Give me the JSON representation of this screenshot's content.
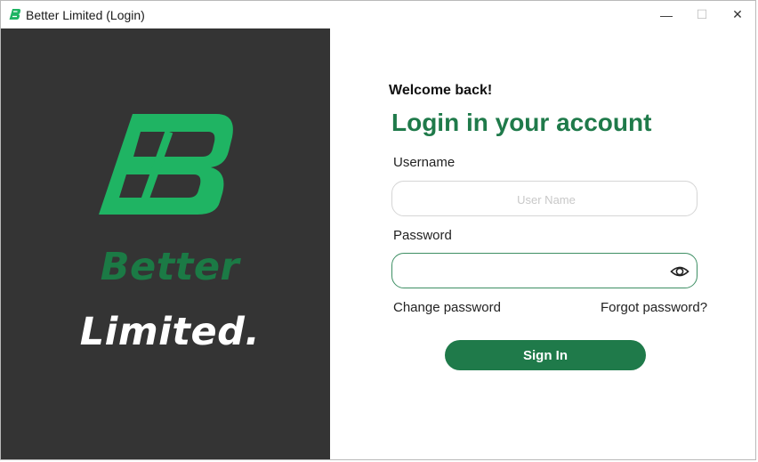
{
  "window": {
    "title": "Better Limited (Login)",
    "minimize": "—",
    "maximize": "☐",
    "close": "✕"
  },
  "brand": {
    "name_top": "Better",
    "name_bottom": "Limited.",
    "logo_color": "#1fb463",
    "accent_color": "#1f7a4a",
    "panel_color": "#343434"
  },
  "login": {
    "welcome": "Welcome back!",
    "heading": "Login in your account",
    "username_label": "Username",
    "username_placeholder": "User Name",
    "username_value": "",
    "password_label": "Password",
    "password_value": "",
    "change_password": "Change password",
    "forgot_password": "Forgot password?",
    "sign_in": "Sign In"
  }
}
